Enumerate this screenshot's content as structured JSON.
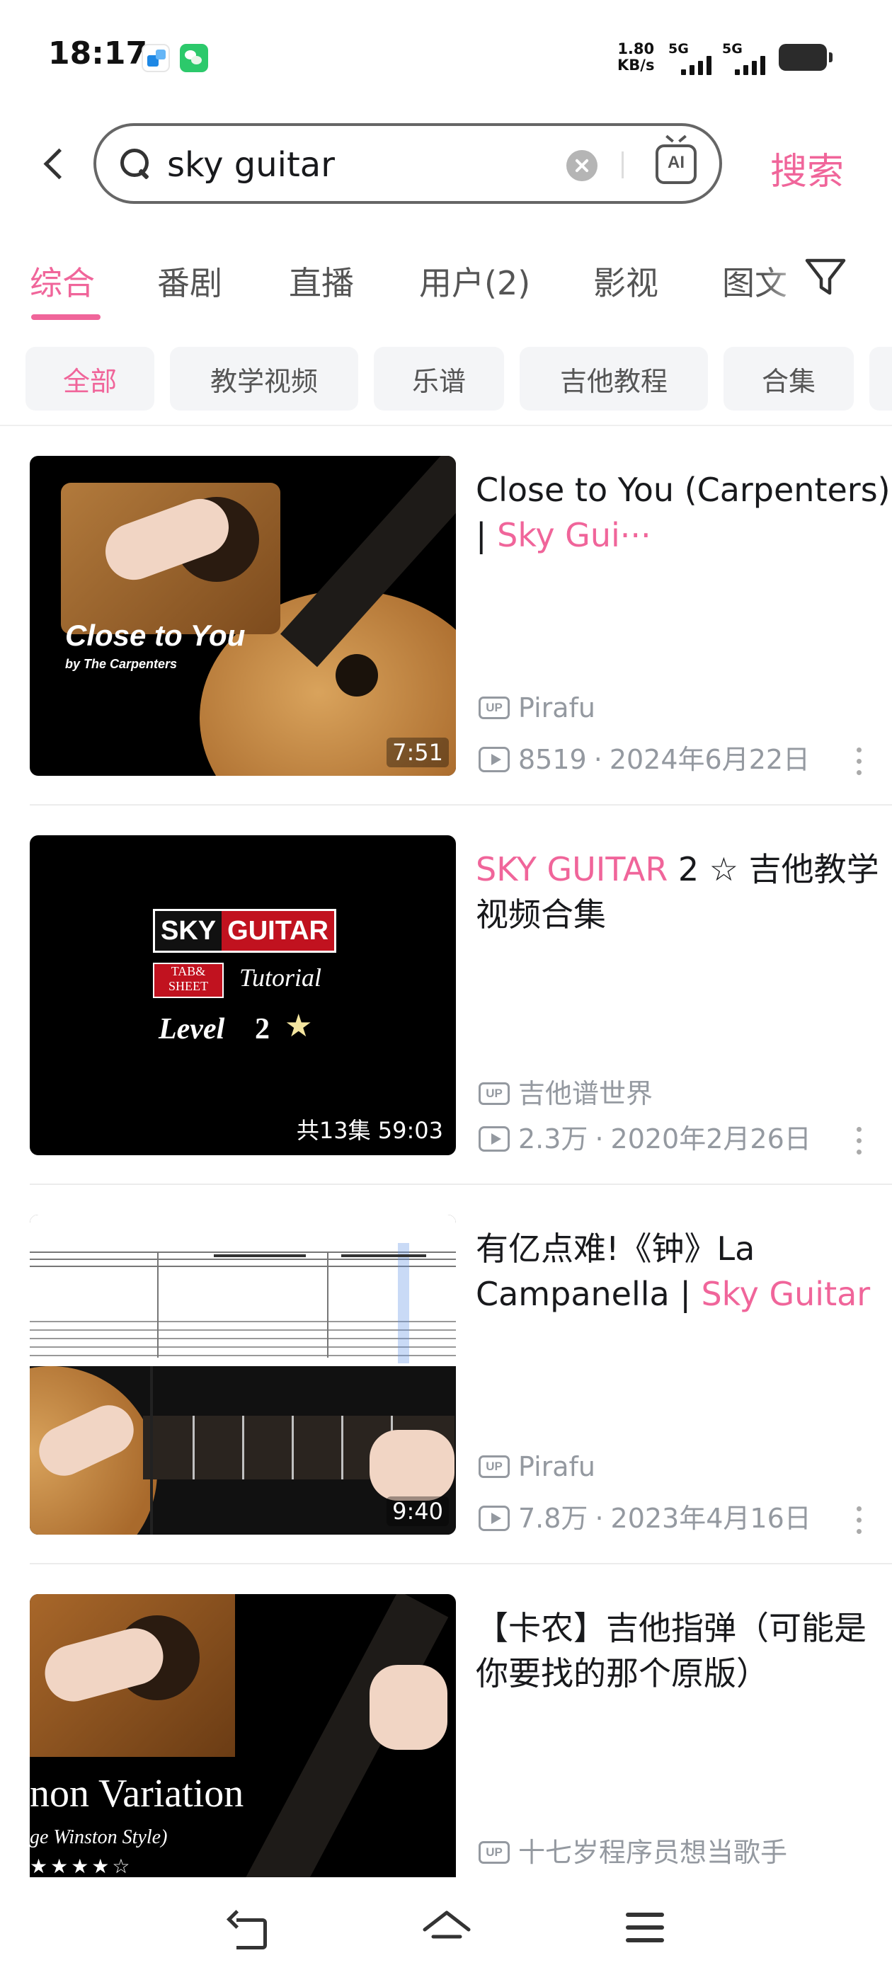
{
  "status_bar": {
    "time": "18:17",
    "net_speed_value": "1.80",
    "net_speed_unit": "KB/s",
    "signal_1": "5G",
    "signal_2": "5G",
    "icons": [
      "app-notification-icon",
      "wechat-icon",
      "signal-icon",
      "battery-icon"
    ]
  },
  "header": {
    "search_value": "sky guitar",
    "search_button": "搜索"
  },
  "tabs": [
    {
      "label": "综合",
      "active": true
    },
    {
      "label": "番剧",
      "active": false
    },
    {
      "label": "直播",
      "active": false
    },
    {
      "label": "用户(2)",
      "active": false
    },
    {
      "label": "影视",
      "active": false
    },
    {
      "label": "图文",
      "active": false
    }
  ],
  "chips": [
    {
      "label": "全部",
      "active": true
    },
    {
      "label": "教学视频",
      "active": false
    },
    {
      "label": "乐谱",
      "active": false
    },
    {
      "label": "吉他教程",
      "active": false
    },
    {
      "label": "合集",
      "active": false
    }
  ],
  "videos": [
    {
      "title_plain": "Close to You (Carpenters) | ",
      "title_highlight": "Sky Gui···",
      "author": "Pirafu",
      "views": "8519",
      "date": "2024年6月22日",
      "duration": "7:51",
      "thumb_title": "Close to You",
      "thumb_subtitle": "by The Carpenters"
    },
    {
      "title_highlight": "SKY GUITAR",
      "title_plain": " 2 ☆ 吉他教学视频合集",
      "author": "吉他谱世界",
      "views": "2.3万",
      "date": "2020年2月26日",
      "duration": "共13集 59:03",
      "thumb_brand_1": "SKY",
      "thumb_brand_2": "GUITAR",
      "thumb_tab_1": "TAB&",
      "thumb_tab_2": "SHEET",
      "thumb_tutorial": "Tutorial",
      "thumb_level": "Level",
      "thumb_level_num": "2",
      "thumb_star": "★"
    },
    {
      "title_plain": "有亿点难!《钟》La Campanella | ",
      "title_highlight": "Sky Guitar",
      "author": "Pirafu",
      "views": "7.8万",
      "date": "2023年4月16日",
      "duration": "9:40"
    },
    {
      "title_plain": "【卡农】吉他指弹（可能是你要找的那个原版）",
      "author": "十七岁程序员想当歌手",
      "thumb_title": "non Variation",
      "thumb_subtitle": "ge Winston Style)",
      "thumb_stars": "★★★★☆"
    }
  ],
  "labels": {
    "up": "UP",
    "dot": "·"
  }
}
